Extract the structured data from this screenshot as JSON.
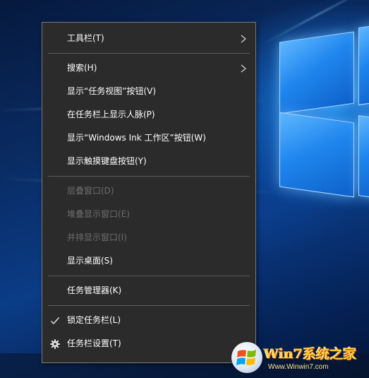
{
  "context_menu": {
    "items": [
      {
        "label": "工具栏(T)",
        "submenu": true,
        "disabled": false
      },
      {
        "label": "搜索(H)",
        "submenu": true,
        "disabled": false
      },
      {
        "label": "显示“任务视图”按钮(V)",
        "disabled": false
      },
      {
        "label": "在任务栏上显示人脉(P)",
        "disabled": false
      },
      {
        "label": "显示“Windows Ink 工作区”按钮(W)",
        "disabled": false
      },
      {
        "label": "显示触摸键盘按钮(Y)",
        "disabled": false
      },
      {
        "label": "层叠窗口(D)",
        "disabled": true
      },
      {
        "label": "堆叠显示窗口(E)",
        "disabled": true
      },
      {
        "label": "并排显示窗口(I)",
        "disabled": true
      },
      {
        "label": "显示桌面(S)",
        "disabled": false
      },
      {
        "label": "任务管理器(K)",
        "disabled": false
      },
      {
        "label": "锁定任务栏(L)",
        "checked": true,
        "disabled": false
      },
      {
        "label": "任务栏设置(T)",
        "icon": "gear-icon",
        "disabled": false
      }
    ]
  },
  "watermark": {
    "brand": "Win7系统之家",
    "url": "Www.Winwin7.com"
  },
  "colors": {
    "menu_bg": "#2b2b2b",
    "menu_text": "#ffffff",
    "menu_disabled_text": "#6e6e6e",
    "separator": "#5a5a5a",
    "watermark_text": "#ffd23a"
  }
}
